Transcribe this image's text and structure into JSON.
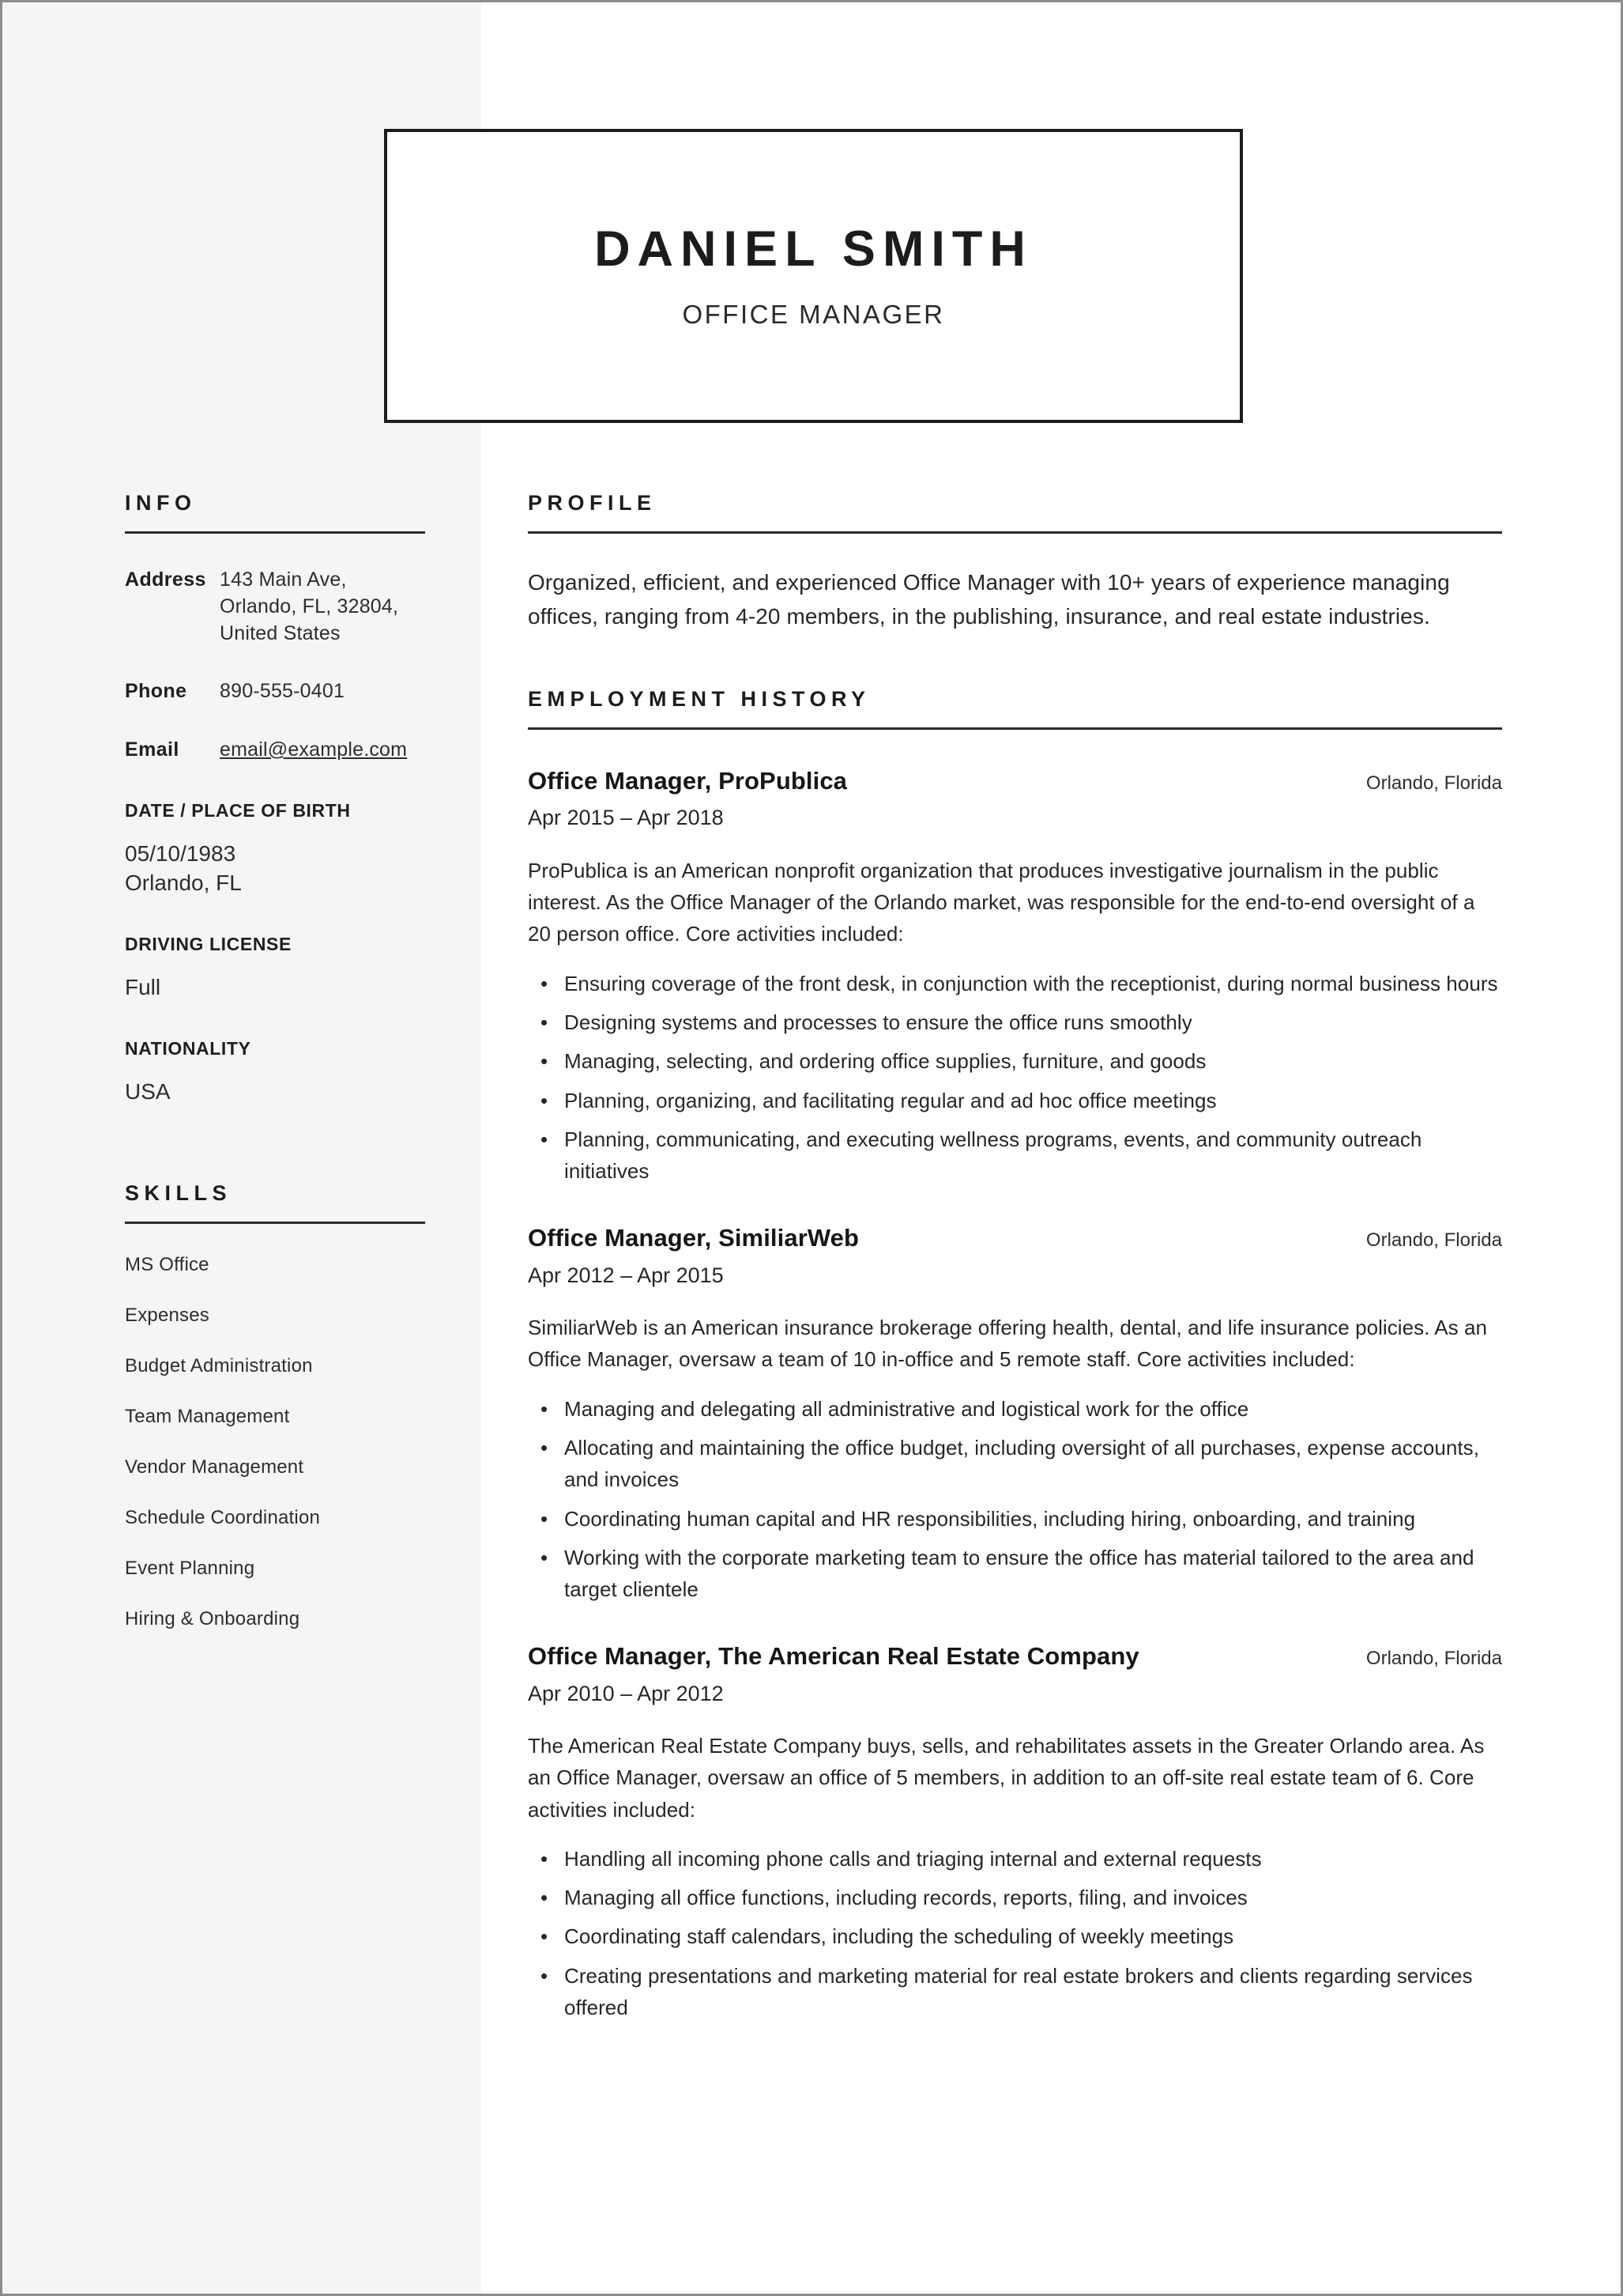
{
  "document": {
    "type": "resume",
    "accent_color": "#1c1c1c",
    "sidebar_bg": "#f5f5f5",
    "page_bg": "#ffffff"
  },
  "header": {
    "name": "Daniel Smith",
    "job_title": "Office Manager"
  },
  "sidebar": {
    "info": {
      "heading": "Info",
      "rows": [
        {
          "label": "Address",
          "value": "143 Main Ave, Orlando, FL, 32804, United States",
          "is_link": false
        },
        {
          "label": "Phone",
          "value": "890-555-0401",
          "is_link": false
        },
        {
          "label": "Email",
          "value": "email@example.com",
          "is_link": true
        }
      ]
    },
    "details": [
      {
        "heading": "Date / Place of Birth",
        "value": "05/10/1983\nOrlando, FL"
      },
      {
        "heading": "Driving License",
        "value": "Full"
      },
      {
        "heading": "Nationality",
        "value": "USA"
      }
    ],
    "skills": {
      "heading": "Skills",
      "items": [
        "MS Office",
        "Expenses",
        "Budget Administration",
        "Team Management",
        "Vendor Management",
        "Schedule Coordination",
        "Event Planning",
        "Hiring & Onboarding"
      ]
    }
  },
  "main": {
    "profile": {
      "heading": "Profile",
      "text": "Organized, efficient, and experienced Office Manager with 10+ years of experience managing offices, ranging from 4-20 members, in the publishing, insurance, and real estate industries."
    },
    "employment": {
      "heading": "Employment History",
      "jobs": [
        {
          "role": "Office Manager, ProPublica",
          "location": "Orlando, Florida",
          "dates": "Apr 2015 – Apr 2018",
          "description": "ProPublica is an American nonprofit organization that produces investigative journalism in the public interest. As the Office Manager of the Orlando market, was responsible for the end-to-end oversight of a 20 person office. Core activities included:",
          "bullets": [
            "Ensuring coverage of the front desk, in conjunction with the receptionist, during normal business hours",
            "Designing systems and processes to ensure the office runs smoothly",
            "Managing, selecting, and ordering office supplies, furniture, and goods",
            "Planning, organizing, and facilitating regular and ad hoc office meetings",
            "Planning, communicating, and executing wellness programs, events, and community outreach initiatives"
          ]
        },
        {
          "role": "Office Manager, SimiliarWeb",
          "location": "Orlando, Florida",
          "dates": "Apr 2012 – Apr 2015",
          "description": "SimiliarWeb is an American insurance brokerage offering health, dental, and life insurance policies. As an Office Manager, oversaw a team of 10 in-office and 5 remote staff. Core activities included:",
          "bullets": [
            "Managing and delegating all administrative and logistical work for the office",
            "Allocating and maintaining the office budget, including oversight of all purchases, expense accounts, and invoices",
            "Coordinating human capital and HR responsibilities, including hiring, onboarding, and training",
            "Working with the corporate marketing team to ensure the office has material tailored to the area and target clientele"
          ]
        },
        {
          "role": "Office Manager, The American Real Estate Company",
          "location": "Orlando, Florida",
          "dates": "Apr 2010 – Apr 2012",
          "description": "The American Real Estate Company buys, sells, and rehabilitates assets in the Greater Orlando area. As an Office Manager, oversaw an office of 5 members, in addition to an off-site real estate team of 6. Core activities included:",
          "bullets": [
            "Handling all incoming phone calls and triaging internal and external requests",
            "Managing all office functions, including records, reports, filing, and invoices",
            "Coordinating staff calendars, including the scheduling of weekly meetings",
            "Creating presentations and marketing material for real estate brokers and clients regarding services offered"
          ]
        }
      ]
    }
  }
}
